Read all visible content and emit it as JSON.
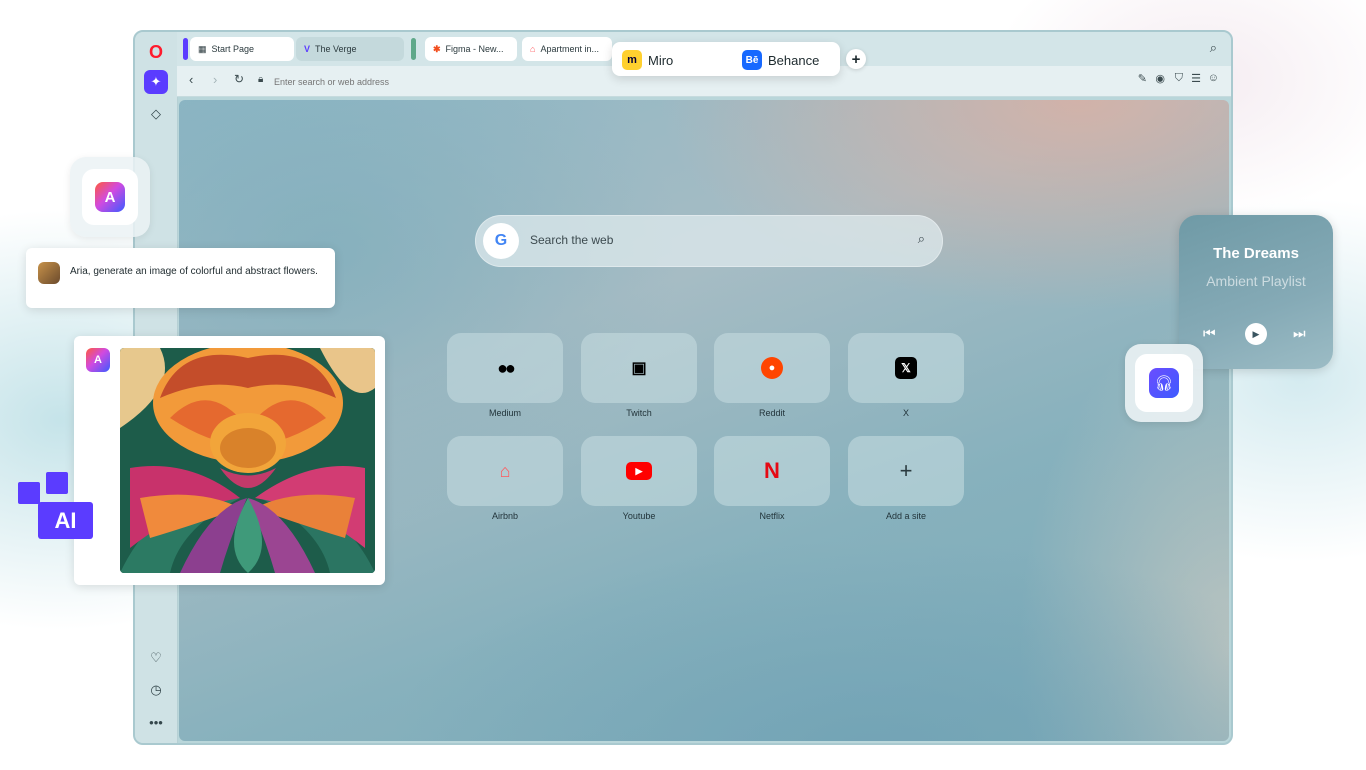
{
  "tabs": {
    "group1": [
      {
        "label": "Start Page",
        "icon": "grid-icon"
      },
      {
        "label": "The Verge",
        "icon": "verge-icon"
      }
    ],
    "group2": [
      {
        "label": "Figma - New...",
        "icon": "figma-icon"
      },
      {
        "label": "Apartment in...",
        "icon": "airbnb-icon"
      }
    ],
    "floating": [
      {
        "label": "Miro",
        "icon": "miro-icon"
      },
      {
        "label": "Behance",
        "icon": "behance-icon",
        "icon_text": "Bē"
      }
    ]
  },
  "address_bar": {
    "placeholder": "Enter search or web address"
  },
  "search": {
    "placeholder": "Search the web",
    "engine_letter": "G"
  },
  "speed_dial": [
    {
      "label": "Medium",
      "icon": "medium-icon",
      "glyph": "●●"
    },
    {
      "label": "Twitch",
      "icon": "twitch-icon",
      "glyph": "▣"
    },
    {
      "label": "Reddit",
      "icon": "reddit-icon",
      "glyph": "●"
    },
    {
      "label": "X",
      "icon": "x-icon",
      "glyph": "𝕏"
    },
    {
      "label": "Airbnb",
      "icon": "airbnb-icon",
      "glyph": "⌂"
    },
    {
      "label": "Youtube",
      "icon": "youtube-icon",
      "glyph": "▶"
    },
    {
      "label": "Netflix",
      "icon": "netflix-icon",
      "glyph": "N"
    },
    {
      "label": "Add a site",
      "icon": "plus-icon",
      "glyph": "+"
    }
  ],
  "aria_chat": {
    "message": "Aria, generate an image of colorful and abstract flowers."
  },
  "ai_badge": {
    "text": "AI"
  },
  "music_player": {
    "title": "The Dreams",
    "subtitle": "Ambient Playlist"
  },
  "colors": {
    "accent": "#5b3cff",
    "opera_red": "#ff1b2d",
    "youtube_red": "#ff0000",
    "netflix_red": "#e50914",
    "reddit_orange": "#ff4500"
  }
}
